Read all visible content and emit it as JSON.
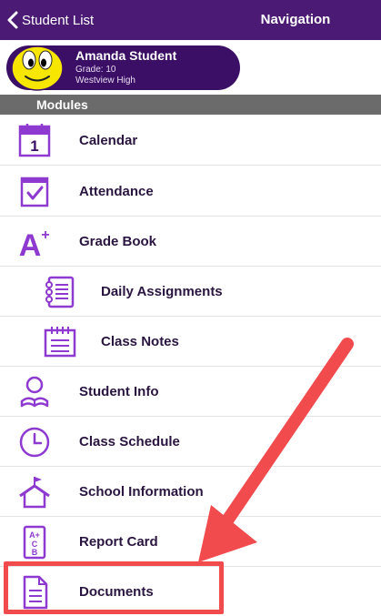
{
  "topbar": {
    "back_label": "Student List",
    "title": "Navigation"
  },
  "profile": {
    "name": "Amanda Student",
    "grade": "Grade: 10",
    "school": "Westview High"
  },
  "modules": {
    "header": "Modules",
    "items": [
      {
        "label": "Calendar",
        "icon": "calendar-icon"
      },
      {
        "label": "Attendance",
        "icon": "attendance-checkbox-icon"
      },
      {
        "label": "Grade Book",
        "icon": "grade-a-plus-icon"
      },
      {
        "label": "Daily Assignments",
        "icon": "notebook-list-icon"
      },
      {
        "label": "Class Notes",
        "icon": "notepad-icon"
      },
      {
        "label": "Student Info",
        "icon": "student-reading-icon"
      },
      {
        "label": "Class Schedule",
        "icon": "clock-icon"
      },
      {
        "label": "School Information",
        "icon": "school-house-icon"
      },
      {
        "label": "Report Card",
        "icon": "report-card-icon"
      },
      {
        "label": "Documents",
        "icon": "document-icon"
      }
    ]
  },
  "colors": {
    "brand": "#4a1a75",
    "pill": "#3c0f66",
    "icon": "#8e3ad1",
    "annotation": "#f24b4e",
    "section_header": "#6b6b6b"
  }
}
